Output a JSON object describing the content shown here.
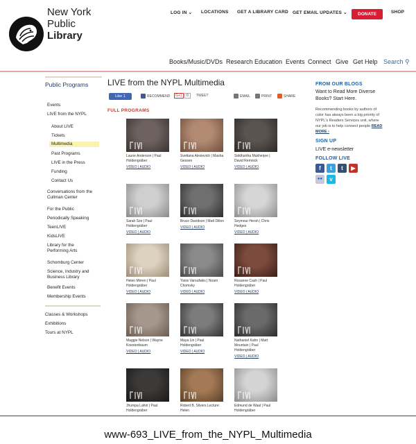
{
  "brand": {
    "line1": "New York",
    "line2": "Public",
    "line3": "Library"
  },
  "topnav": {
    "login": "LOG IN",
    "locations": "LOCATIONS",
    "library_card": "GET A LIBRARY CARD",
    "email_updates": "GET EMAIL UPDATES",
    "donate": "DONATE",
    "shop": "SHOP"
  },
  "mainnav": {
    "books": "Books/Music/DVDs",
    "research": "Research",
    "education": "Education",
    "events": "Events",
    "connect": "Connect",
    "give": "Give",
    "get_help": "Get Help",
    "search": "Search"
  },
  "sidebar": {
    "title": "Public Programs",
    "items": [
      "Events",
      "LIVE from the NYPL",
      "About LIVE",
      "Tickets",
      "Multimedia",
      "Past Programs",
      "LIVE in the Press",
      "Funding",
      "Contact Us",
      "Conversations from the Cullman Center",
      "For the Public",
      "Periodically Speaking",
      "TeenLIVE",
      "KidsLIVE",
      "Library for the Performing Arts",
      "Schomburg Center",
      "Science, Industry and Business Library",
      "Benefit Events",
      "Membership Events",
      "Classes & Workshops",
      "Exhibitions",
      "Tours at NYPL"
    ]
  },
  "main": {
    "title": "LIVE from the NYPL Multimedia",
    "share": {
      "like": "Like 1",
      "recommend": "RECOMMEND",
      "gplus": "G+1",
      "gcount": "0",
      "tweet": "TWEET",
      "email": "EMAIL",
      "print": "PRINT",
      "share": "SHARE"
    },
    "section": "FULL PROGRAMS",
    "cards": [
      {
        "caption": "Laurie Anderson | Paul Holdengräber",
        "links": "VIDEO | AUDIO"
      },
      {
        "caption": "Svetlana Alexievich | Masha Gessen",
        "links": "VIDEO | AUDIO"
      },
      {
        "caption": "Siddhartha Mukherjee | David Remnick",
        "links": "VIDEO | AUDIO"
      },
      {
        "caption": "Sarah Sze | Paul Holdengräber",
        "links": "VIDEO | AUDIO"
      },
      {
        "caption": "Bruce Davidson | Matt Dillon",
        "links": "VIDEO | AUDIO"
      },
      {
        "caption": "Seymour Hersh | Chris Hedges",
        "links": "VIDEO | AUDIO"
      },
      {
        "caption": "Helen Mirren | Paul Holdengräber",
        "links": "VIDEO | AUDIO"
      },
      {
        "caption": "Yanis Varoufakis | Noam Chomsky",
        "links": "VIDEO | AUDIO"
      },
      {
        "caption": "Rosanne Cash | Paul Holdengräber",
        "links": "VIDEO | AUDIO"
      },
      {
        "caption": "Maggie Nelson | Wayne Koestenbaum",
        "links": "VIDEO | AUDIO"
      },
      {
        "caption": "Maya Lin | Paul Holdengräber",
        "links": "VIDEO | AUDIO"
      },
      {
        "caption": "Nathaniel Kahn | Matt Mountain | Paul Holdengräber",
        "links": "VIDEO | AUDIO"
      },
      {
        "caption": "Jhumpa Lahiri | Paul Holdengräber",
        "links": ""
      },
      {
        "caption": "Robert B. Silvers Lecture: Helen",
        "links": ""
      },
      {
        "caption": "Edmund de Waal | Paul Holdengräber",
        "links": ""
      }
    ]
  },
  "right": {
    "blogs_head": "FROM OUR BLOGS",
    "blog_link": "Want to Read More Diverse Books? Start Here.",
    "blog_body": "Recommending books by authors of color has always been a big priority of NYPL's Readers Services unit, where our job is to help connect people",
    "read_more": "READ MORE ›",
    "signup_head": "SIGN UP",
    "signup_link": "LIVE e-newsletter",
    "follow_head": "FOLLOW LIVE"
  },
  "colors": {
    "accent": "#d61e35",
    "link": "#1f3b66",
    "heading_blue": "#1f5fa6",
    "highlight": "#faf3b0"
  },
  "page_caption": "www-693_LIVE_from_the_NYPL_Multimedia"
}
